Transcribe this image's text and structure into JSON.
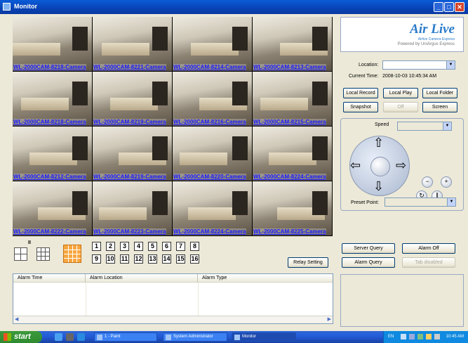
{
  "window": {
    "title": "Monitor",
    "min_glyph": "_",
    "max_glyph": "□",
    "close_glyph": "✕"
  },
  "cameras": [
    {
      "label": "WL-2000CAM-8218-Camera"
    },
    {
      "label": "WL-2000CAM-8221-Camera"
    },
    {
      "label": "WL-2000CAM-8214-Camera"
    },
    {
      "label": "WL-2000CAM-8213-Camera"
    },
    {
      "label": "WL-2000CAM-8218-Camera"
    },
    {
      "label": "WL-2000CAM-8219-Camera"
    },
    {
      "label": "WL-2000CAM-8216-Camera"
    },
    {
      "label": "WL-2000CAM-8215-Camera"
    },
    {
      "label": "WL-2000CAM-8212-Camera"
    },
    {
      "label": "WL-2000CAM-8219-Camera"
    },
    {
      "label": "WL-2000CAM-8220-Camera"
    },
    {
      "label": "WL-2000CAM-8224-Camera"
    },
    {
      "label": "WL-2000CAM-8222-Camera"
    },
    {
      "label": "WL-2000CAM-8223-Camera"
    },
    {
      "label": "WL-2000CAM-8224-Camera"
    },
    {
      "label": "WL-2000CAM-8225-Camera"
    }
  ],
  "logo": {
    "brand": "Air Live",
    "tagline": "Airlive Camera Express",
    "powered": "Powered by UniArgus Express"
  },
  "location": {
    "label": "Location:",
    "value": ""
  },
  "current_time": {
    "label": "Current Time:",
    "value": "2008-10-03 10:45:34 AM"
  },
  "buttons": {
    "local_record": "Local Record",
    "local_play": "Local Play",
    "local_folder": "Local Folder",
    "snapshot": "Snapshot",
    "off": "Off",
    "screen": "Screen",
    "relay_setting": "Relay Setting",
    "server_query": "Server Query",
    "alarm_off": "Alarm Off",
    "alarm_query": "Alarm Query",
    "tab_disabled": "Tab disabled"
  },
  "ptz": {
    "speed_label": "Speed",
    "speed_value": "",
    "preset_label": "Preset Point:",
    "preset_value": "",
    "zoom_out": "−",
    "zoom_in": "+"
  },
  "layout_selector": {
    "top_label": "II"
  },
  "channels_row1": [
    "1",
    "2",
    "3",
    "4",
    "5",
    "6",
    "7",
    "8"
  ],
  "channels_row2": [
    "9",
    "10",
    "11",
    "12",
    "13",
    "14",
    "15",
    "16"
  ],
  "alarm_table": {
    "columns": [
      "Alarm Time",
      "Alarm Location",
      "Alarm Type"
    ]
  },
  "taskbar": {
    "start": "start",
    "tasks": [
      "1 - Paint",
      "System Administrator",
      "Monitor"
    ],
    "tray_lang": "EN",
    "tray_time": "10:45 AM"
  }
}
